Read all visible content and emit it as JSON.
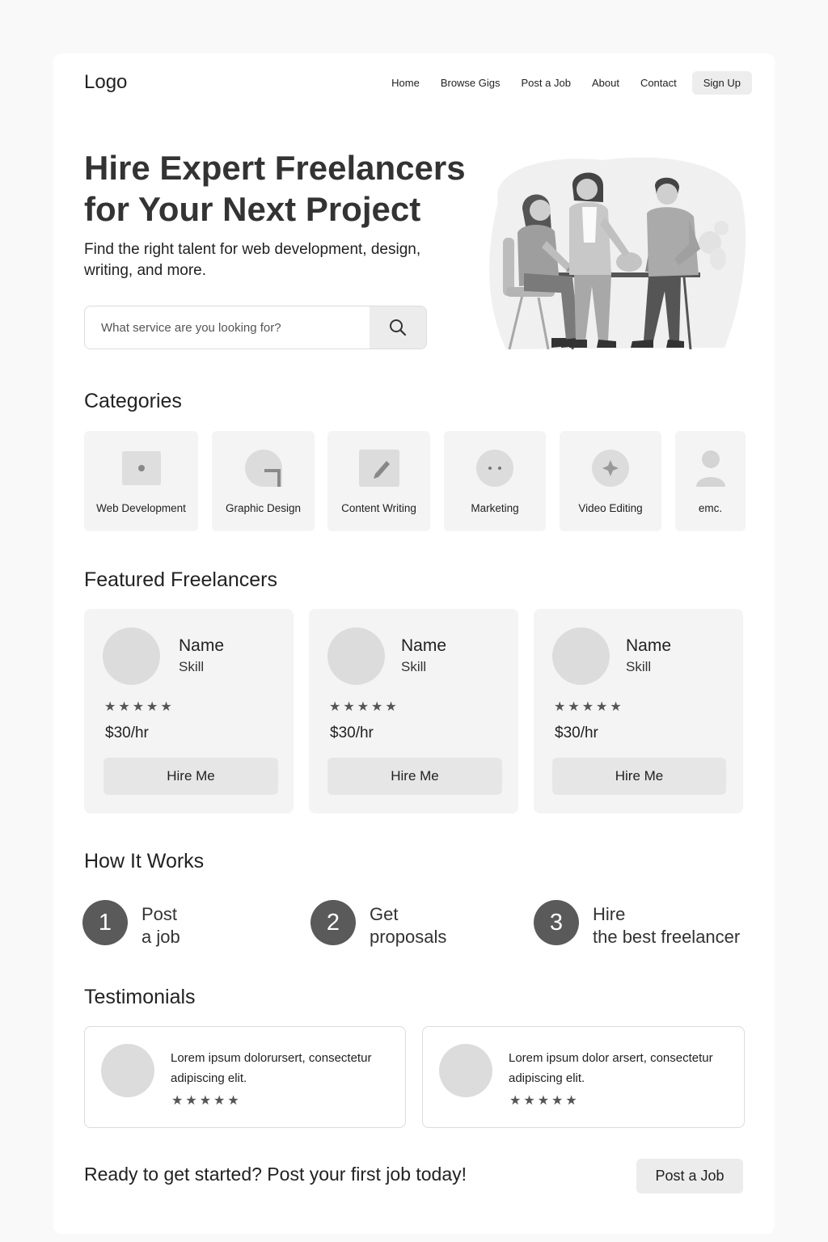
{
  "header": {
    "logo": "Logo",
    "nav": [
      "Home",
      "Browse Gigs",
      "Post a Job",
      "About",
      "Contact"
    ],
    "signup": "Sign Up"
  },
  "hero": {
    "title_line1": "Hire Expert Freelancers",
    "title_line2": "for Your Next Project",
    "subtitle": "Find the right talent for web development, design, writing, and more.",
    "search_placeholder": "What service are you looking for?",
    "search_icon": "search-icon",
    "illustration": "team-meeting-illustration"
  },
  "categories": {
    "title": "Categories",
    "items": [
      {
        "label": "Web Development",
        "icon": "browser-window-icon"
      },
      {
        "label": "Graphic Design",
        "icon": "design-shape-icon"
      },
      {
        "label": "Content Writing",
        "icon": "pen-document-icon"
      },
      {
        "label": "Marketing",
        "icon": "chat-bubble-icon"
      },
      {
        "label": "Video Editing",
        "icon": "sparkle-icon"
      },
      {
        "label": "emc.",
        "icon": "person-icon"
      }
    ]
  },
  "featured": {
    "title": "Featured Freelancers",
    "cards": [
      {
        "name": "Name",
        "skill": "Skill",
        "stars": "★★★★★",
        "rating": 5,
        "rate": "$30/hr",
        "button": "Hire Me"
      },
      {
        "name": "Name",
        "skill": "Skill",
        "stars": "★★★★★",
        "rating": 5,
        "rate": "$30/hr",
        "button": "Hire Me"
      },
      {
        "name": "Name",
        "skill": "Skill",
        "stars": "★★★★★",
        "rating": 5,
        "rate": "$30/hr",
        "button": "Hire Me"
      }
    ]
  },
  "how": {
    "title": "How It Works",
    "steps": [
      {
        "num": "1",
        "line1": "Post",
        "line2": "a job"
      },
      {
        "num": "2",
        "line1": "Get",
        "line2": "proposals"
      },
      {
        "num": "3",
        "line1": "Hire",
        "line2": "the best freelancer"
      }
    ]
  },
  "testimonials": {
    "title": "Testimonials",
    "items": [
      {
        "text": "Lorem ipsum dolorursert, consectetur adipiscing elit.",
        "stars": "★★★★★",
        "rating": 5
      },
      {
        "text": "Lorem ipsum dolor arsert, consectetur adipiscing elit.",
        "stars": "★★★★★",
        "rating": 5
      }
    ]
  },
  "cta": {
    "text": "Ready to get started? Post your first job today!",
    "button": "Post a Job"
  },
  "colors": {
    "background": "#f9f9f9",
    "card": "#f4f4f4",
    "button": "#e6e6e6",
    "step_circle": "#5a5a5a",
    "avatar": "#dcdcdc"
  }
}
